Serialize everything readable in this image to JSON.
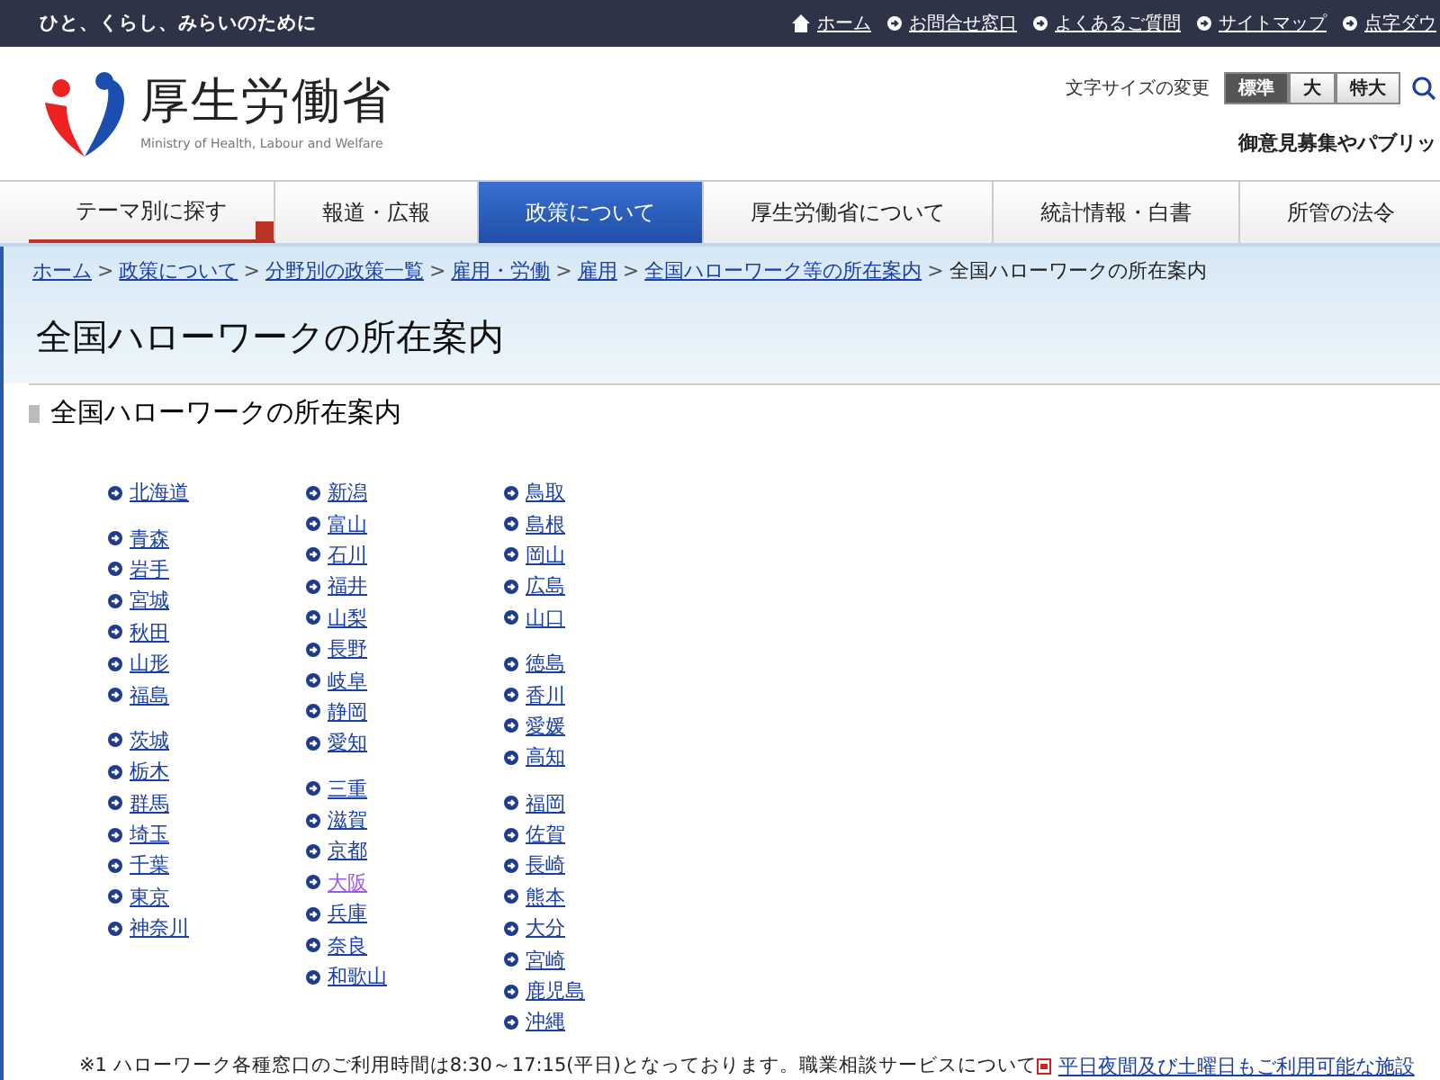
{
  "top_bar": {
    "tagline": "ひと、くらし、みらいのために",
    "links": [
      {
        "kind": "home",
        "label": "ホーム"
      },
      {
        "kind": "arrow",
        "label": "お問合せ窓口"
      },
      {
        "kind": "arrow",
        "label": "よくあるご質問"
      },
      {
        "kind": "arrow",
        "label": "サイトマップ"
      },
      {
        "kind": "arrow",
        "label": "点字ダウ"
      }
    ]
  },
  "header": {
    "logo_title": "厚生労働省",
    "logo_subtitle": "Ministry of Health, Labour and Welfare",
    "font_size_label": "文字サイズの変更",
    "font_sizes": [
      {
        "label": "標準",
        "selected": true
      },
      {
        "label": "大",
        "selected": false
      },
      {
        "label": "特大",
        "selected": false
      }
    ],
    "notice": "御意見募集やパブリッ"
  },
  "nav": [
    {
      "label": "テーマ別に探す",
      "selected": false,
      "dropdown": true
    },
    {
      "label": "報道・広報",
      "selected": false,
      "dropdown": false
    },
    {
      "label": "政策について",
      "selected": true,
      "dropdown": false
    },
    {
      "label": "厚生労働省について",
      "selected": false,
      "dropdown": false
    },
    {
      "label": "統計情報・白書",
      "selected": false,
      "dropdown": false
    },
    {
      "label": "所管の法令",
      "selected": false,
      "dropdown": false
    }
  ],
  "breadcrumb": {
    "separator": ">",
    "links": [
      "ホーム",
      "政策について",
      "分野別の政策一覧",
      "雇用・労働",
      "雇用",
      "全国ハローワーク等の所在案内"
    ],
    "current": "全国ハローワークの所在案内"
  },
  "page_title": "全国ハローワークの所在案内",
  "section_title": "全国ハローワークの所在案内",
  "prefecture_columns": [
    [
      [
        {
          "name": "北海道",
          "visited": false
        }
      ],
      [
        {
          "name": "青森",
          "visited": false
        },
        {
          "name": "岩手",
          "visited": false
        },
        {
          "name": "宮城",
          "visited": false
        },
        {
          "name": "秋田",
          "visited": false
        },
        {
          "name": "山形",
          "visited": false
        },
        {
          "name": "福島",
          "visited": false
        }
      ],
      [
        {
          "name": "茨城",
          "visited": false
        },
        {
          "name": "栃木",
          "visited": false
        },
        {
          "name": "群馬",
          "visited": false
        },
        {
          "name": "埼玉",
          "visited": false
        },
        {
          "name": "千葉",
          "visited": false
        },
        {
          "name": "東京",
          "visited": false
        },
        {
          "name": "神奈川",
          "visited": false
        }
      ]
    ],
    [
      [
        {
          "name": "新潟",
          "visited": false
        },
        {
          "name": "富山",
          "visited": false
        },
        {
          "name": "石川",
          "visited": false
        },
        {
          "name": "福井",
          "visited": false
        },
        {
          "name": "山梨",
          "visited": false
        },
        {
          "name": "長野",
          "visited": false
        },
        {
          "name": "岐阜",
          "visited": false
        },
        {
          "name": "静岡",
          "visited": false
        },
        {
          "name": "愛知",
          "visited": false
        }
      ],
      [
        {
          "name": "三重",
          "visited": false
        },
        {
          "name": "滋賀",
          "visited": false
        },
        {
          "name": "京都",
          "visited": false
        },
        {
          "name": "大阪",
          "visited": true
        },
        {
          "name": "兵庫",
          "visited": false
        },
        {
          "name": "奈良",
          "visited": false
        },
        {
          "name": "和歌山",
          "visited": false
        }
      ]
    ],
    [
      [
        {
          "name": "鳥取",
          "visited": false
        },
        {
          "name": "島根",
          "visited": false
        },
        {
          "name": "岡山",
          "visited": false
        },
        {
          "name": "広島",
          "visited": false
        },
        {
          "name": "山口",
          "visited": false
        }
      ],
      [
        {
          "name": "徳島",
          "visited": false
        },
        {
          "name": "香川",
          "visited": false
        },
        {
          "name": "愛媛",
          "visited": false
        },
        {
          "name": "高知",
          "visited": false
        }
      ],
      [
        {
          "name": "福岡",
          "visited": false
        },
        {
          "name": "佐賀",
          "visited": false
        },
        {
          "name": "長崎",
          "visited": false
        },
        {
          "name": "熊本",
          "visited": false
        },
        {
          "name": "大分",
          "visited": false
        },
        {
          "name": "宮崎",
          "visited": false
        },
        {
          "name": "鹿児島",
          "visited": false
        },
        {
          "name": "沖縄",
          "visited": false
        }
      ]
    ]
  ],
  "footnote": {
    "text": "※1 ハローワーク各種窓口のご利用時間は8:30～17:15(平日)となっております。職業相談サービスについて",
    "link": "平日夜間及び土曜日もご利用可能な施設"
  }
}
